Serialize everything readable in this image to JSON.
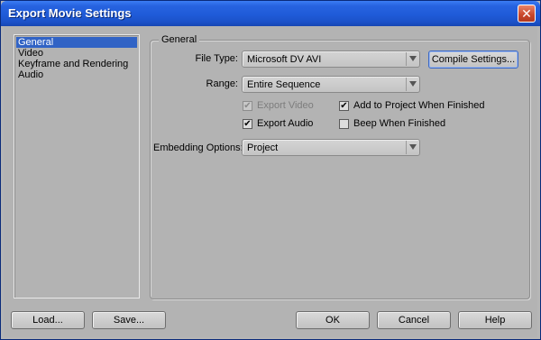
{
  "window": {
    "title": "Export Movie Settings",
    "close_glyph": "✕"
  },
  "categories": [
    "General",
    "Video",
    "Keyframe and Rendering",
    "Audio"
  ],
  "selected_category": "General",
  "panel": {
    "title": "General",
    "file_type": {
      "label": "File Type:",
      "value": "Microsoft DV AVI"
    },
    "compile_settings_label": "Compile Settings...",
    "range": {
      "label": "Range:",
      "value": "Entire Sequence"
    },
    "checkboxes": {
      "export_video": {
        "label": "Export Video",
        "checked": true,
        "disabled": true
      },
      "export_audio": {
        "label": "Export Audio",
        "checked": true,
        "disabled": false
      },
      "add_to_project": {
        "label": "Add to Project When Finished",
        "checked": true,
        "disabled": false
      },
      "beep": {
        "label": "Beep When Finished",
        "checked": false,
        "disabled": false
      }
    },
    "embedding": {
      "label": "Embedding Options:",
      "value": "Project"
    }
  },
  "buttons": {
    "load": "Load...",
    "save": "Save...",
    "ok": "OK",
    "cancel": "Cancel",
    "help": "Help"
  },
  "check_glyph": "✔",
  "colors": {
    "titlebar": "#2763e0",
    "selection": "#3163c5",
    "background": "#b3b3b3"
  }
}
